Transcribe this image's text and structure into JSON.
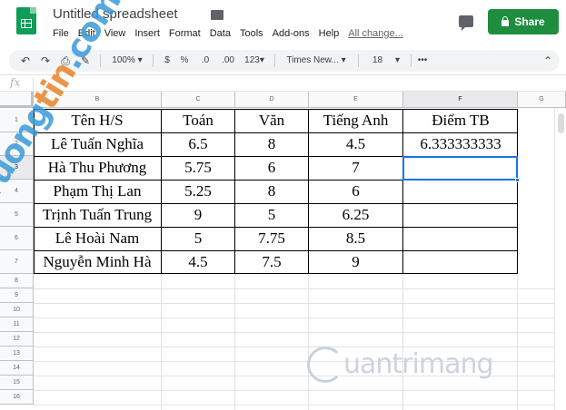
{
  "app": {
    "title": "Untitled spreadsheet",
    "menus": [
      "File",
      "Edit",
      "View",
      "Insert",
      "Format",
      "Data",
      "Tools",
      "Add-ons",
      "Help"
    ],
    "last_edit": "All change...",
    "share_label": "Share"
  },
  "toolbar": {
    "zoom": "100%",
    "currency": "$",
    "percent": "%",
    "dec_decrease": ".0",
    "dec_increase": ".00",
    "format_more": "123",
    "font": "Times New...",
    "font_size": "18",
    "more": "•••"
  },
  "formula_bar": {
    "fx": "fx",
    "value": ""
  },
  "sheet": {
    "columns": [
      "B",
      "C",
      "D",
      "E",
      "F",
      "G"
    ],
    "rows": [
      "1",
      "2",
      "3",
      "4",
      "5",
      "6",
      "7",
      "8",
      "9",
      "10",
      "11",
      "12",
      "13",
      "14",
      "15",
      "16"
    ],
    "headers": [
      "Tên H/S",
      "Toán",
      "Văn",
      "Tiếng Anh",
      "Điểm TB"
    ],
    "records": [
      [
        "Lê Tuấn Nghĩa",
        "6.5",
        "8",
        "4.5",
        "6.333333333"
      ],
      [
        "Hà Thu Phương",
        "5.75",
        "6",
        "7",
        ""
      ],
      [
        "Phạm Thị Lan",
        "5.25",
        "8",
        "6",
        ""
      ],
      [
        "Trịnh Tuấn Trung",
        "9",
        "5",
        "6.25",
        ""
      ],
      [
        "Lê Hoài Nam",
        "5",
        "7.75",
        "8.5",
        ""
      ],
      [
        "Nguyễn Minh Hà",
        "4.5",
        "7.5",
        "9",
        ""
      ]
    ],
    "active_cell": "F3"
  },
  "watermarks": {
    "left_a": "Truong",
    "left_b": "tin",
    "left_c": ".com",
    "right": "uantrimang"
  },
  "colors": {
    "accent": "#1a73e8",
    "share_green": "#1e8e3e",
    "sheets_green": "#0f9d58"
  }
}
